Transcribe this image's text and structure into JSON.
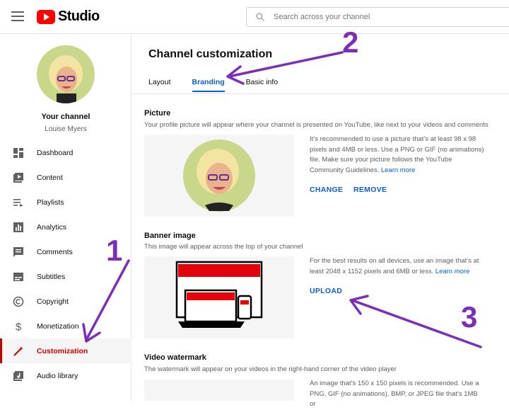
{
  "topbar": {
    "logo_text": "Studio",
    "search_placeholder": "Search across your channel"
  },
  "sidebar": {
    "your_channel": "Your channel",
    "channel_name": "Louise Myers",
    "items": [
      {
        "label": "Dashboard",
        "icon": "dashboard-icon"
      },
      {
        "label": "Content",
        "icon": "content-icon"
      },
      {
        "label": "Playlists",
        "icon": "playlists-icon"
      },
      {
        "label": "Analytics",
        "icon": "analytics-icon"
      },
      {
        "label": "Comments",
        "icon": "comments-icon"
      },
      {
        "label": "Subtitles",
        "icon": "subtitles-icon"
      },
      {
        "label": "Copyright",
        "icon": "copyright-icon"
      },
      {
        "label": "Monetization",
        "icon": "monetization-icon"
      },
      {
        "label": "Customization",
        "icon": "customization-icon",
        "active": true
      },
      {
        "label": "Audio library",
        "icon": "audio-library-icon"
      }
    ]
  },
  "main": {
    "title": "Channel customization",
    "tabs": [
      {
        "label": "Layout"
      },
      {
        "label": "Branding",
        "active": true
      },
      {
        "label": "Basic info"
      }
    ],
    "picture": {
      "title": "Picture",
      "desc": "Your profile picture will appear where your channel is presented on YouTube, like next to your videos and comments",
      "info": "It’s recommended to use a picture that’s at least 98 x 98 pixels and 4MB or less. Use a PNG or GIF (no animations) file. Make sure your picture follows the YouTube Community Guidelines.",
      "learn_more": "Learn more",
      "change_label": "CHANGE",
      "remove_label": "REMOVE"
    },
    "banner": {
      "title": "Banner image",
      "desc": "This image will appear across the top of your channel",
      "info": "For the best results on all devices, use an image that’s at least 2048 x 1152 pixels and 6MB or less.",
      "learn_more": "Learn more",
      "upload_label": "UPLOAD"
    },
    "watermark": {
      "title": "Video watermark",
      "desc": "The watermark will appear on your videos in the right-hand corner of the video player",
      "info": "An image that’s 150 x 150 pixels is recommended. Use a PNG, GIF (no animations), BMP, or JPEG file that’s 1MB or"
    }
  },
  "annotations": {
    "one": "1",
    "two": "2",
    "three": "3",
    "color": "#7b2fb8"
  },
  "colors": {
    "accent": "#065fd4",
    "active_red": "#cc0000",
    "brand_red": "#ff0000"
  }
}
